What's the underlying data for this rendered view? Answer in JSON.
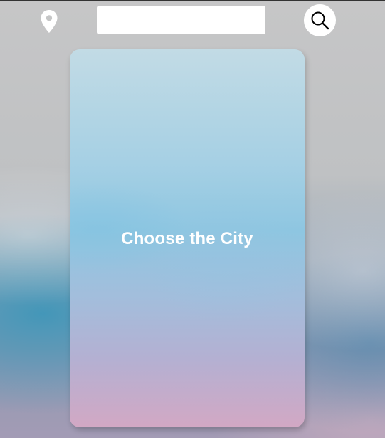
{
  "toolbar": {
    "location_icon": "map-pin-icon",
    "search": {
      "value": "",
      "placeholder": ""
    },
    "search_icon": "magnifier-icon"
  },
  "card": {
    "message": "Choose the City"
  },
  "colors": {
    "icon": "#ffffff",
    "card_text": "#ffffff",
    "search_icon": "#000000"
  }
}
